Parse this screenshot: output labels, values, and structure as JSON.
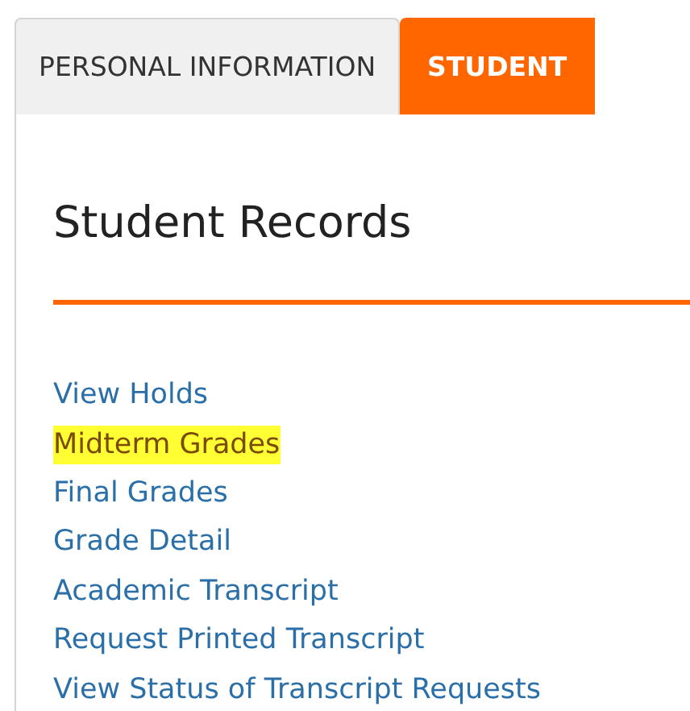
{
  "tabs": [
    {
      "label": "PERSONAL INFORMATION",
      "selected": false
    },
    {
      "label": "STUDENT",
      "selected": true
    }
  ],
  "section": {
    "title": "Student Records"
  },
  "links": [
    {
      "label": "View Holds",
      "highlighted": false
    },
    {
      "label": "Midterm Grades",
      "highlighted": true
    },
    {
      "label": "Final Grades",
      "highlighted": false
    },
    {
      "label": "Grade Detail",
      "highlighted": false
    },
    {
      "label": "Academic Transcript",
      "highlighted": false
    },
    {
      "label": "Request Printed Transcript",
      "highlighted": false
    },
    {
      "label": "View Status of Transcript Requests",
      "highlighted": false
    }
  ]
}
